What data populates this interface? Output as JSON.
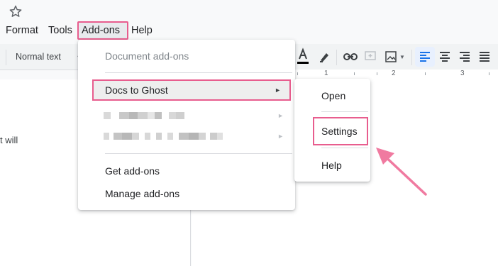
{
  "menubar": {
    "format": "Format",
    "tools": "Tools",
    "addons": "Add-ons",
    "help": "Help"
  },
  "toolbar": {
    "style_select": "Normal text"
  },
  "ruler": {
    "marks": [
      "1",
      "2",
      "3"
    ]
  },
  "doc": {
    "left_fragment": "t will"
  },
  "addons_menu": {
    "header": "Document add-ons",
    "docs_to_ghost": "Docs to Ghost",
    "get_addons": "Get add-ons",
    "manage_addons": "Manage add-ons",
    "submenu_arrow": "►"
  },
  "submenu": {
    "open": "Open",
    "settings": "Settings",
    "help": "Help"
  },
  "colors": {
    "highlight": "#e85d8e",
    "accent_blue": "#1a73e8"
  }
}
